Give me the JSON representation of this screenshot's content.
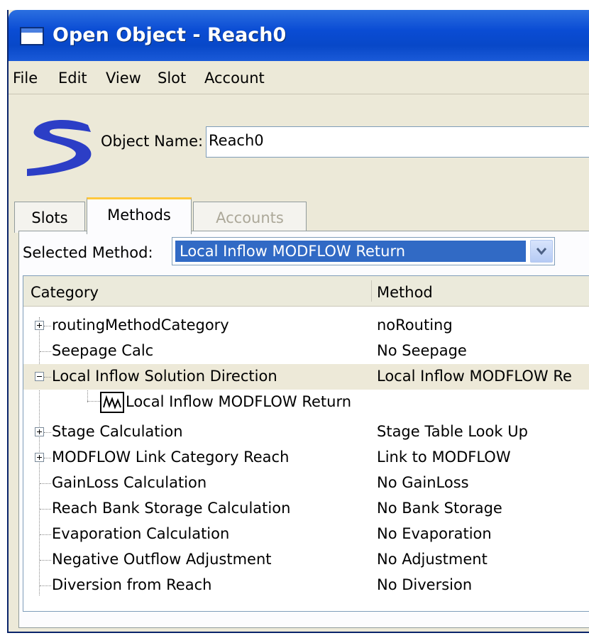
{
  "window": {
    "title": "Open Object - Reach0"
  },
  "menu": [
    "File",
    "Edit",
    "View",
    "Slot",
    "Account"
  ],
  "object": {
    "label": "Object Name:",
    "value": "Reach0"
  },
  "tabs": [
    "Slots",
    "Methods",
    "Accounts"
  ],
  "selected_method": {
    "label": "Selected Method:",
    "value": "Local Inflow MODFLOW Return"
  },
  "table": {
    "headers": [
      "Category",
      "Method"
    ],
    "rows": [
      {
        "category": "routingMethodCategory",
        "method": "noRouting"
      },
      {
        "category": "Seepage Calc",
        "method": "No Seepage"
      },
      {
        "category": "Local Inflow Solution Direction",
        "method": "Local Inflow MODFLOW Re"
      },
      {
        "category": "Local Inflow MODFLOW Return",
        "method": ""
      },
      {
        "category": "Stage Calculation",
        "method": "Stage Table Look Up"
      },
      {
        "category": "MODFLOW Link Category Reach",
        "method": "Link to MODFLOW"
      },
      {
        "category": "GainLoss Calculation",
        "method": "No GainLoss"
      },
      {
        "category": "Reach Bank Storage Calculation",
        "method": "No Bank Storage"
      },
      {
        "category": "Evaporation Calculation",
        "method": "No Evaporation"
      },
      {
        "category": "Negative Outflow Adjustment",
        "method": "No Adjustment"
      },
      {
        "category": "Diversion from Reach",
        "method": "No Diversion"
      }
    ]
  },
  "colors": {
    "titlebar": "#0a4cd4",
    "selection": "#316ac5",
    "active_tab_accent": "#ffc83c"
  }
}
